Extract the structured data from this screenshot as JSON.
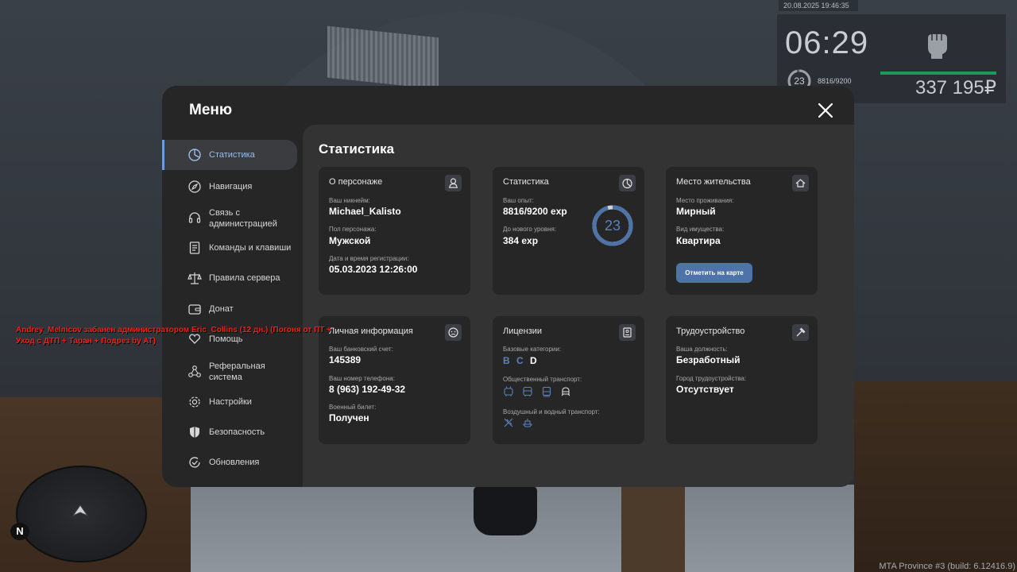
{
  "hud": {
    "date": "20.08.2025 19:46:35",
    "time": "06:29",
    "level": "23",
    "exp": "8816/9200",
    "money": "337 195₽",
    "colors": {
      "health_bar": "#1f9b57"
    }
  },
  "menu": {
    "title": "Меню",
    "close_icon": "close-icon",
    "nav": [
      {
        "label": "Статистика",
        "icon": "stats-icon",
        "active": true
      },
      {
        "label": "Навигация",
        "icon": "compass-icon"
      },
      {
        "label": "Связь с\nадминистрацией",
        "icon": "headset-icon"
      },
      {
        "label": "Команды и клавиши",
        "icon": "document-icon"
      },
      {
        "label": "Правила сервера",
        "icon": "scales-icon"
      },
      {
        "label": "Донат",
        "icon": "wallet-icon"
      },
      {
        "label": "Помощь",
        "icon": "heart-hand-icon"
      },
      {
        "label": "Реферальная\nсистема",
        "icon": "network-icon"
      },
      {
        "label": "Настройки",
        "icon": "gear-icon"
      },
      {
        "label": "Безопасность",
        "icon": "shield-icon"
      },
      {
        "label": "Обновления",
        "icon": "refresh-check-icon"
      }
    ]
  },
  "content": {
    "title": "Статистика",
    "cards": {
      "character": {
        "title": "О персонаже",
        "nickname_label": "Ваш никнейм:",
        "nickname": "Michael_Kalisto",
        "gender_label": "Пол персонажа:",
        "gender": "Мужской",
        "reg_label": "Дата и время регистрации:",
        "reg_date": "05.03.2023 12:26:00"
      },
      "stats": {
        "title": "Статистика",
        "exp_label": "Ваш опыт:",
        "exp": "8816/9200 exp",
        "next_label": "До нового уровня:",
        "next": "384 exp",
        "level": "23",
        "progress": 0.958
      },
      "residence": {
        "title": "Место жительства",
        "place_label": "Место проживания:",
        "place": "Мирный",
        "type_label": "Вид имущества:",
        "type": "Квартира",
        "map_button": "Отметить на карте"
      },
      "personal": {
        "title": "Личная информация",
        "bank_label": "Ваш банковский счет:",
        "bank": "145389",
        "phone_label": "Ваш номер телефона:",
        "phone": "8 (963) 192-49-32",
        "military_label": "Военный билет:",
        "military": "Получен"
      },
      "licenses": {
        "title": "Лицензии",
        "base_label": "Базовые категории:",
        "categories": [
          {
            "name": "B",
            "color": "#5b82bf"
          },
          {
            "name": "C",
            "color": "#5b82bf"
          },
          {
            "name": "D",
            "color": "#ffffff"
          }
        ],
        "public_label": "Общественный транспорт:",
        "air_label": "Воздушный и водный транспорт:"
      },
      "employment": {
        "title": "Трудоустройство",
        "position_label": "Ваша должность:",
        "position": "Безработный",
        "city_label": "Город трудоустройства:",
        "city": "Отсутствует"
      }
    }
  },
  "chat": {
    "line1": "Andrey_Melnicov забанен администратором Eric_Collins (12 дн.) (Погоня от ПТ +",
    "line2": "Уход с ДТП + Таран + Подрез by AT)"
  },
  "minimap": {
    "north": "N"
  },
  "build": "MTA Province #3 (build: 6.12416.9)"
}
